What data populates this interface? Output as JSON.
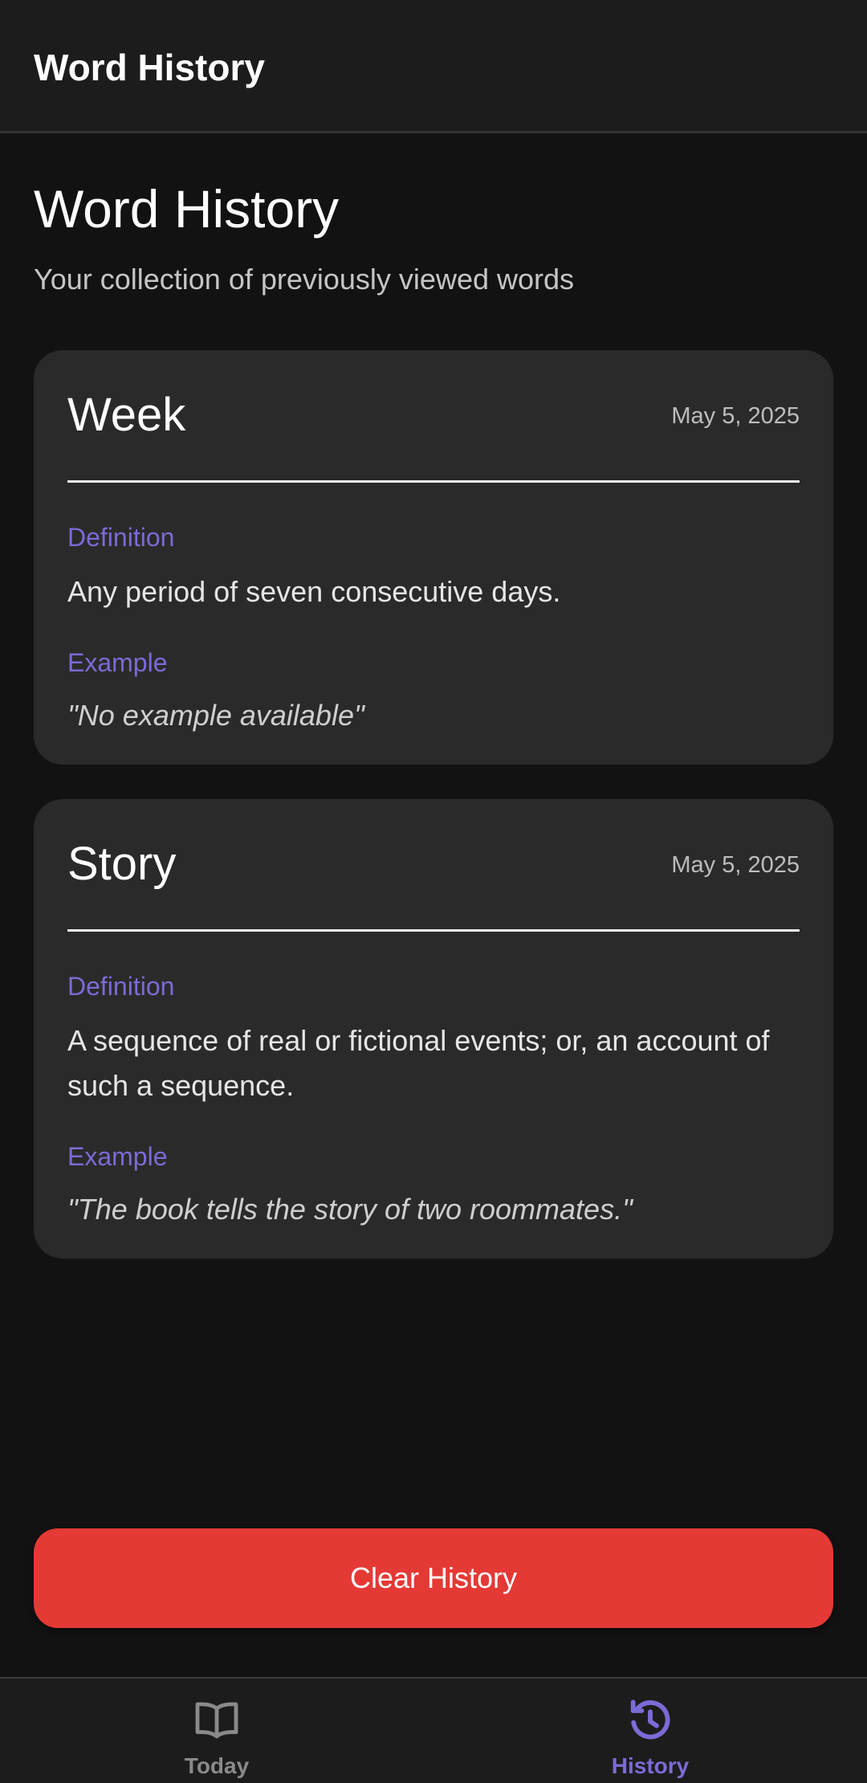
{
  "app_bar": {
    "title": "Word History"
  },
  "page": {
    "title": "Word History",
    "subtitle": "Your collection of previously viewed words"
  },
  "entries": [
    {
      "word": "Week",
      "date": "May 5, 2025",
      "definition_label": "Definition",
      "definition": "Any period of seven consecutive days.",
      "example_label": "Example",
      "example": "\"No example available\""
    },
    {
      "word": "Story",
      "date": "May 5, 2025",
      "definition_label": "Definition",
      "definition": "A sequence of real or fictional events; or, an account of such a sequence.",
      "example_label": "Example",
      "example": "\"The book tells the story of two roommates.\""
    }
  ],
  "clear_button": {
    "label": "Clear History"
  },
  "bottom_nav": {
    "items": [
      {
        "label": "Today",
        "icon": "book-open-icon",
        "active": false
      },
      {
        "label": "History",
        "icon": "history-icon",
        "active": true
      }
    ]
  },
  "colors": {
    "background": "#121212",
    "surface": "#2a2a2a",
    "accent": "#7b6bd6",
    "danger": "#e53935",
    "inactive": "#8a8a8a"
  }
}
